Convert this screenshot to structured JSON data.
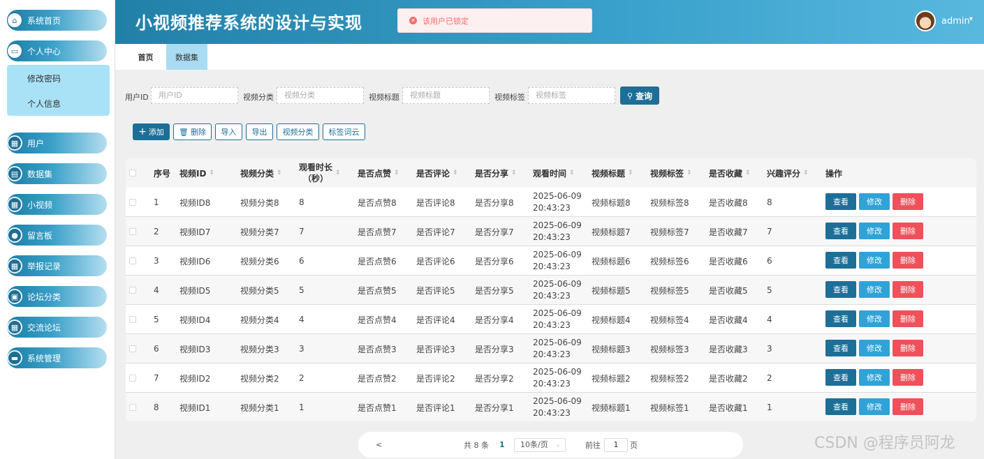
{
  "app": {
    "title": "小视频推荐系统的设计与实现"
  },
  "toast": {
    "message": "该用户已锁定"
  },
  "user": {
    "name": "admin"
  },
  "sidebar": {
    "items": [
      {
        "label": "系统首页",
        "icon": "home-icon"
      },
      {
        "label": "个人中心",
        "icon": "profile-card-icon"
      },
      {
        "label": "用户",
        "icon": "grid-icon"
      },
      {
        "label": "数据集",
        "icon": "briefcase-icon"
      },
      {
        "label": "小视频",
        "icon": "grid-icon"
      },
      {
        "label": "留言板",
        "icon": "bulb-icon"
      },
      {
        "label": "举报记录",
        "icon": "grid-icon"
      },
      {
        "label": "论坛分类",
        "icon": "clipboard-icon"
      },
      {
        "label": "交流论坛",
        "icon": "grid-icon"
      },
      {
        "label": "系统管理",
        "icon": "monitor-icon"
      }
    ],
    "submenu": [
      "修改密码",
      "个人信息"
    ]
  },
  "tabs": [
    "首页",
    "数据集"
  ],
  "search": {
    "fields": [
      {
        "label": "用户ID",
        "placeholder": "用户ID"
      },
      {
        "label": "视频分类",
        "placeholder": "视频分类"
      },
      {
        "label": "视频标题",
        "placeholder": "视频标题"
      },
      {
        "label": "视频标签",
        "placeholder": "视频标签"
      }
    ],
    "button": "查询"
  },
  "toolbar": {
    "add": "添加",
    "delete": "删除",
    "import": "导入",
    "export": "导出",
    "category": "视频分类",
    "tagcloud": "标签词云"
  },
  "table": {
    "headers": [
      "序号",
      "视频ID",
      "视频分类",
      "观看时长(秒)",
      "是否点赞",
      "是否评论",
      "是否分享",
      "观看时间",
      "视频标题",
      "视频标签",
      "是否收藏",
      "兴趣评分",
      "操作"
    ],
    "header_duration_line1": "观看时长",
    "header_duration_line2": "（秒）",
    "rows": [
      [
        "1",
        "视频ID8",
        "视频分类8",
        "8",
        "是否点赞8",
        "是否评论8",
        "是否分享8",
        "2025-06-09 20:43:23",
        "视频标题8",
        "视频标签8",
        "是否收藏8",
        "8"
      ],
      [
        "2",
        "视频ID7",
        "视频分类7",
        "7",
        "是否点赞7",
        "是否评论7",
        "是否分享7",
        "2025-06-09 20:43:23",
        "视频标题7",
        "视频标签7",
        "是否收藏7",
        "7"
      ],
      [
        "3",
        "视频ID6",
        "视频分类6",
        "6",
        "是否点赞6",
        "是否评论6",
        "是否分享6",
        "2025-06-09 20:43:23",
        "视频标题6",
        "视频标签6",
        "是否收藏6",
        "6"
      ],
      [
        "4",
        "视频ID5",
        "视频分类5",
        "5",
        "是否点赞5",
        "是否评论5",
        "是否分享5",
        "2025-06-09 20:43:23",
        "视频标题5",
        "视频标签5",
        "是否收藏5",
        "5"
      ],
      [
        "5",
        "视频ID4",
        "视频分类4",
        "4",
        "是否点赞4",
        "是否评论4",
        "是否分享4",
        "2025-06-09 20:43:23",
        "视频标题4",
        "视频标签4",
        "是否收藏4",
        "4"
      ],
      [
        "6",
        "视频ID3",
        "视频分类3",
        "3",
        "是否点赞3",
        "是否评论3",
        "是否分享3",
        "2025-06-09 20:43:23",
        "视频标题3",
        "视频标签3",
        "是否收藏3",
        "3"
      ],
      [
        "7",
        "视频ID2",
        "视频分类2",
        "2",
        "是否点赞2",
        "是否评论2",
        "是否分享2",
        "2025-06-09 20:43:23",
        "视频标题2",
        "视频标签2",
        "是否收藏2",
        "2"
      ],
      [
        "8",
        "视频ID1",
        "视频分类1",
        "1",
        "是否点赞1",
        "是否评论1",
        "是否分享1",
        "2025-06-09 20:43:23",
        "视频标题1",
        "视频标签1",
        "是否收藏1",
        "1"
      ]
    ],
    "actions": {
      "view": "查看",
      "edit": "修改",
      "delete": "删除"
    }
  },
  "pagination": {
    "prev": "<",
    "total": "共 8 条",
    "current": "1",
    "page_size": "10条/页",
    "goto_label": "前往",
    "goto_value": "1",
    "page_suffix": "页"
  },
  "watermark": "CSDN @程序员阿龙",
  "colors": {
    "primary": "#1d6f97",
    "header": "#2a8ab4",
    "edit": "#2fa3d8",
    "danger": "#f0505a",
    "submenu": "#a9e2f7"
  }
}
